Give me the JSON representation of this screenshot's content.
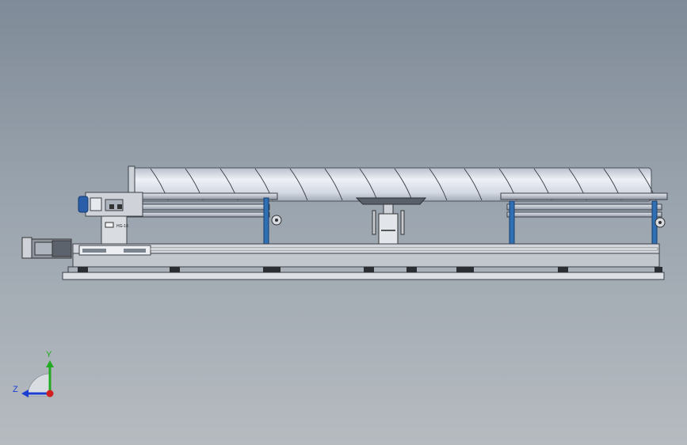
{
  "viewport": {
    "background_top": "#7f8b98",
    "background_bottom": "#b6bbc0"
  },
  "model": {
    "pipe_color": "#dfe3ea",
    "frame_color": "#c8ccd2",
    "support_color": "#2f6fb3",
    "motor_color": "#2a5ea8",
    "label_plate": "HG-18"
  },
  "triad": {
    "y_label": "Y",
    "z_label": "Z",
    "y_color": "#22aa22",
    "z_color": "#1d3fd0",
    "x_color": "#d02020"
  }
}
